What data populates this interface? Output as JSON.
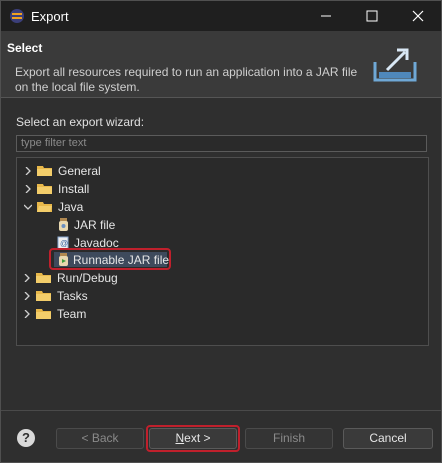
{
  "window": {
    "title": "Export",
    "controls": [
      "minimize-icon",
      "maximize-icon",
      "close-icon"
    ]
  },
  "header": {
    "heading": "Select",
    "description": "Export all resources required to run an application into a JAR file on the local file system.",
    "banner_icon": "export-icon"
  },
  "wizard": {
    "label": "Select an export wizard:",
    "filter_placeholder": "type filter text"
  },
  "tree": [
    {
      "label": "General",
      "expanded": false,
      "icon": "folder-icon"
    },
    {
      "label": "Install",
      "expanded": false,
      "icon": "folder-icon"
    },
    {
      "label": "Java",
      "expanded": true,
      "icon": "folder-icon",
      "children": [
        {
          "label": "JAR file",
          "icon": "jar-icon"
        },
        {
          "label": "Javadoc",
          "icon": "javadoc-icon"
        },
        {
          "label": "Runnable JAR file",
          "icon": "runnable-jar-icon",
          "selected": true
        }
      ]
    },
    {
      "label": "Run/Debug",
      "expanded": false,
      "icon": "folder-icon"
    },
    {
      "label": "Tasks",
      "expanded": false,
      "icon": "folder-icon"
    },
    {
      "label": "Team",
      "expanded": false,
      "icon": "folder-icon"
    }
  ],
  "footer": {
    "help": "?",
    "back": "< Back",
    "next_underlined": "N",
    "next_rest": "ext >",
    "finish": "Finish",
    "cancel": "Cancel"
  },
  "colors": {
    "highlight": "#c0202c",
    "folder": "#e8b84a"
  }
}
